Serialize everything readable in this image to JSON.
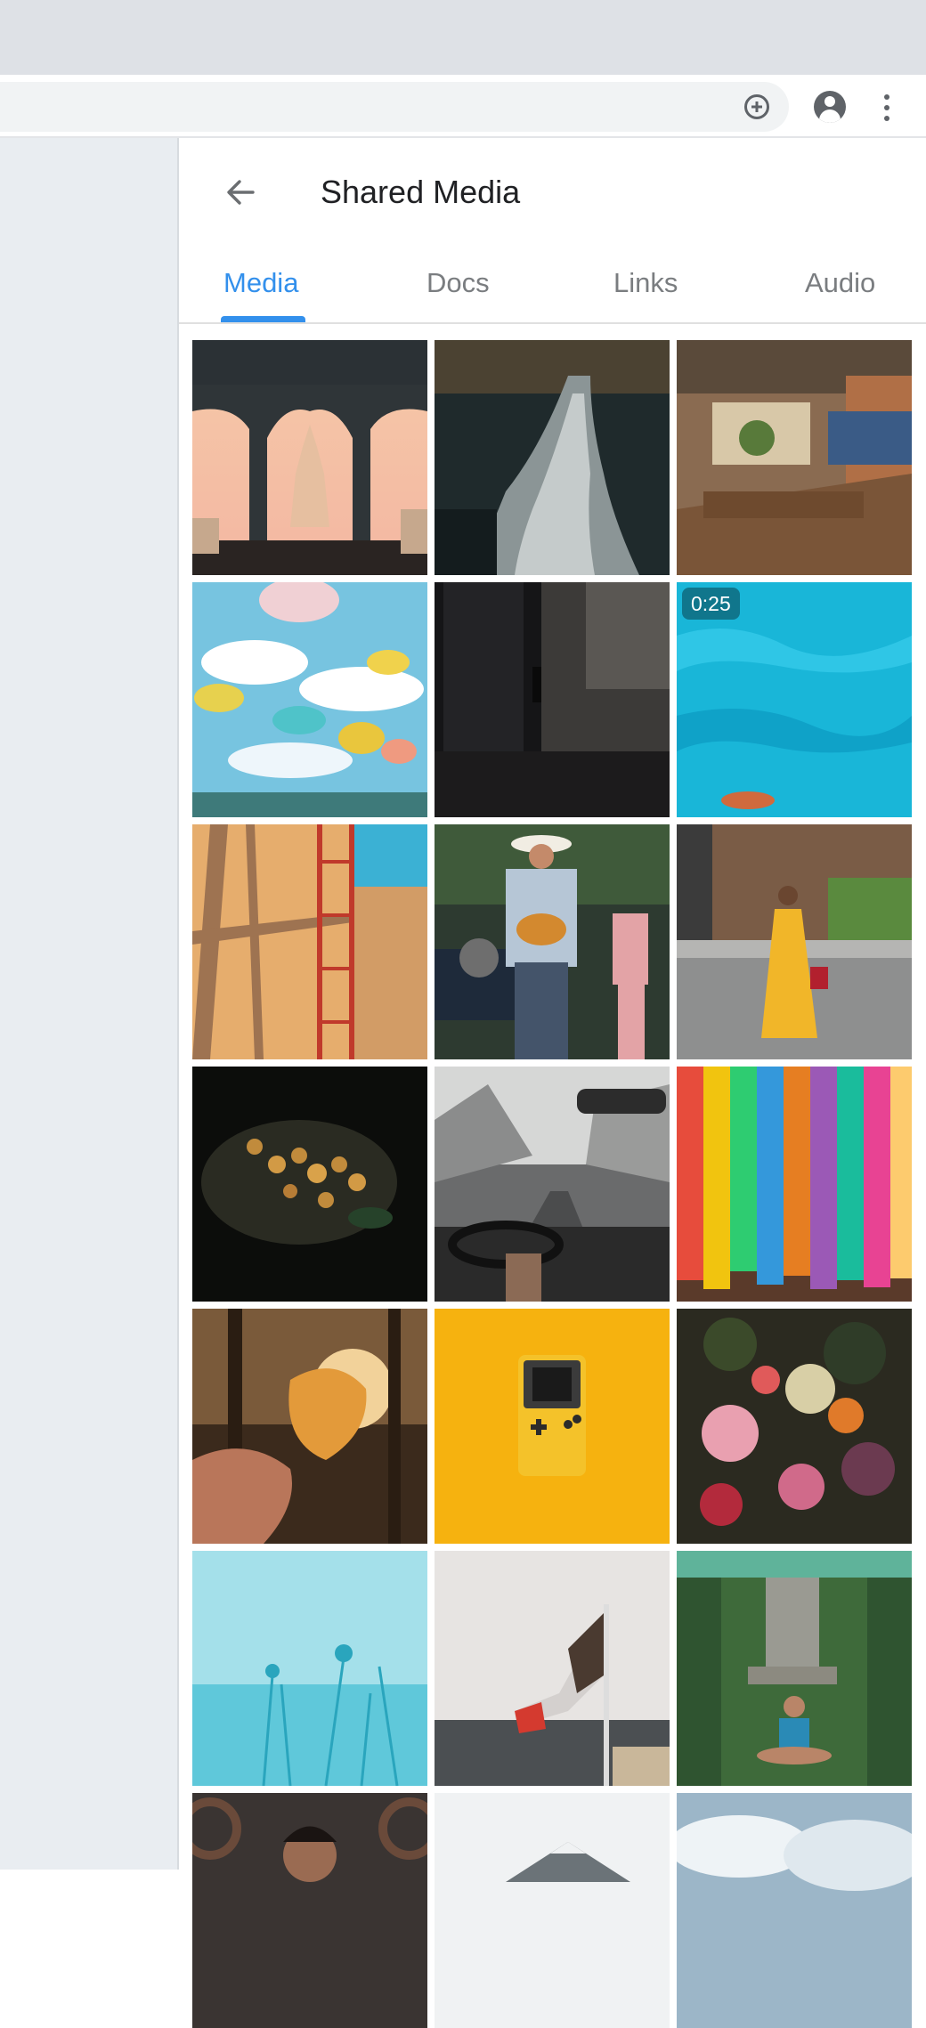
{
  "browser": {
    "icons": [
      "add-icon",
      "account-icon",
      "more-vert-icon"
    ]
  },
  "header": {
    "title": "Shared Media",
    "back_icon": "arrow-back-icon"
  },
  "tabs": [
    {
      "label": "Media",
      "active": true
    },
    {
      "label": "Docs",
      "active": false
    },
    {
      "label": "Links",
      "active": false
    },
    {
      "label": "Audio",
      "active": false
    }
  ],
  "colors": {
    "accent": "#3390ec",
    "sidebar": "#e9edf1",
    "chrome": "#dee1e6"
  },
  "media": [
    {
      "name": "castle-arches-photo"
    },
    {
      "name": "waterfall-photo"
    },
    {
      "name": "restaurant-interior-photo"
    },
    {
      "name": "umbrellas-sky-photo"
    },
    {
      "name": "dark-building-photo"
    },
    {
      "name": "pool-swimmer-video",
      "duration": "0:25"
    },
    {
      "name": "ladder-shadows-photo"
    },
    {
      "name": "guitarist-photo"
    },
    {
      "name": "woman-walking-photo"
    },
    {
      "name": "mushrooms-photo"
    },
    {
      "name": "car-snow-photo"
    },
    {
      "name": "paper-cranes-photo"
    },
    {
      "name": "autumn-leaf-photo"
    },
    {
      "name": "yellow-gameboy-photo"
    },
    {
      "name": "flowers-fruit-photo"
    },
    {
      "name": "cyan-plants-photo"
    },
    {
      "name": "flag-ship-photo"
    },
    {
      "name": "yoga-statue-photo"
    },
    {
      "name": "man-portrait-photo"
    },
    {
      "name": "mountain-photo"
    },
    {
      "name": "clouds-photo"
    }
  ]
}
